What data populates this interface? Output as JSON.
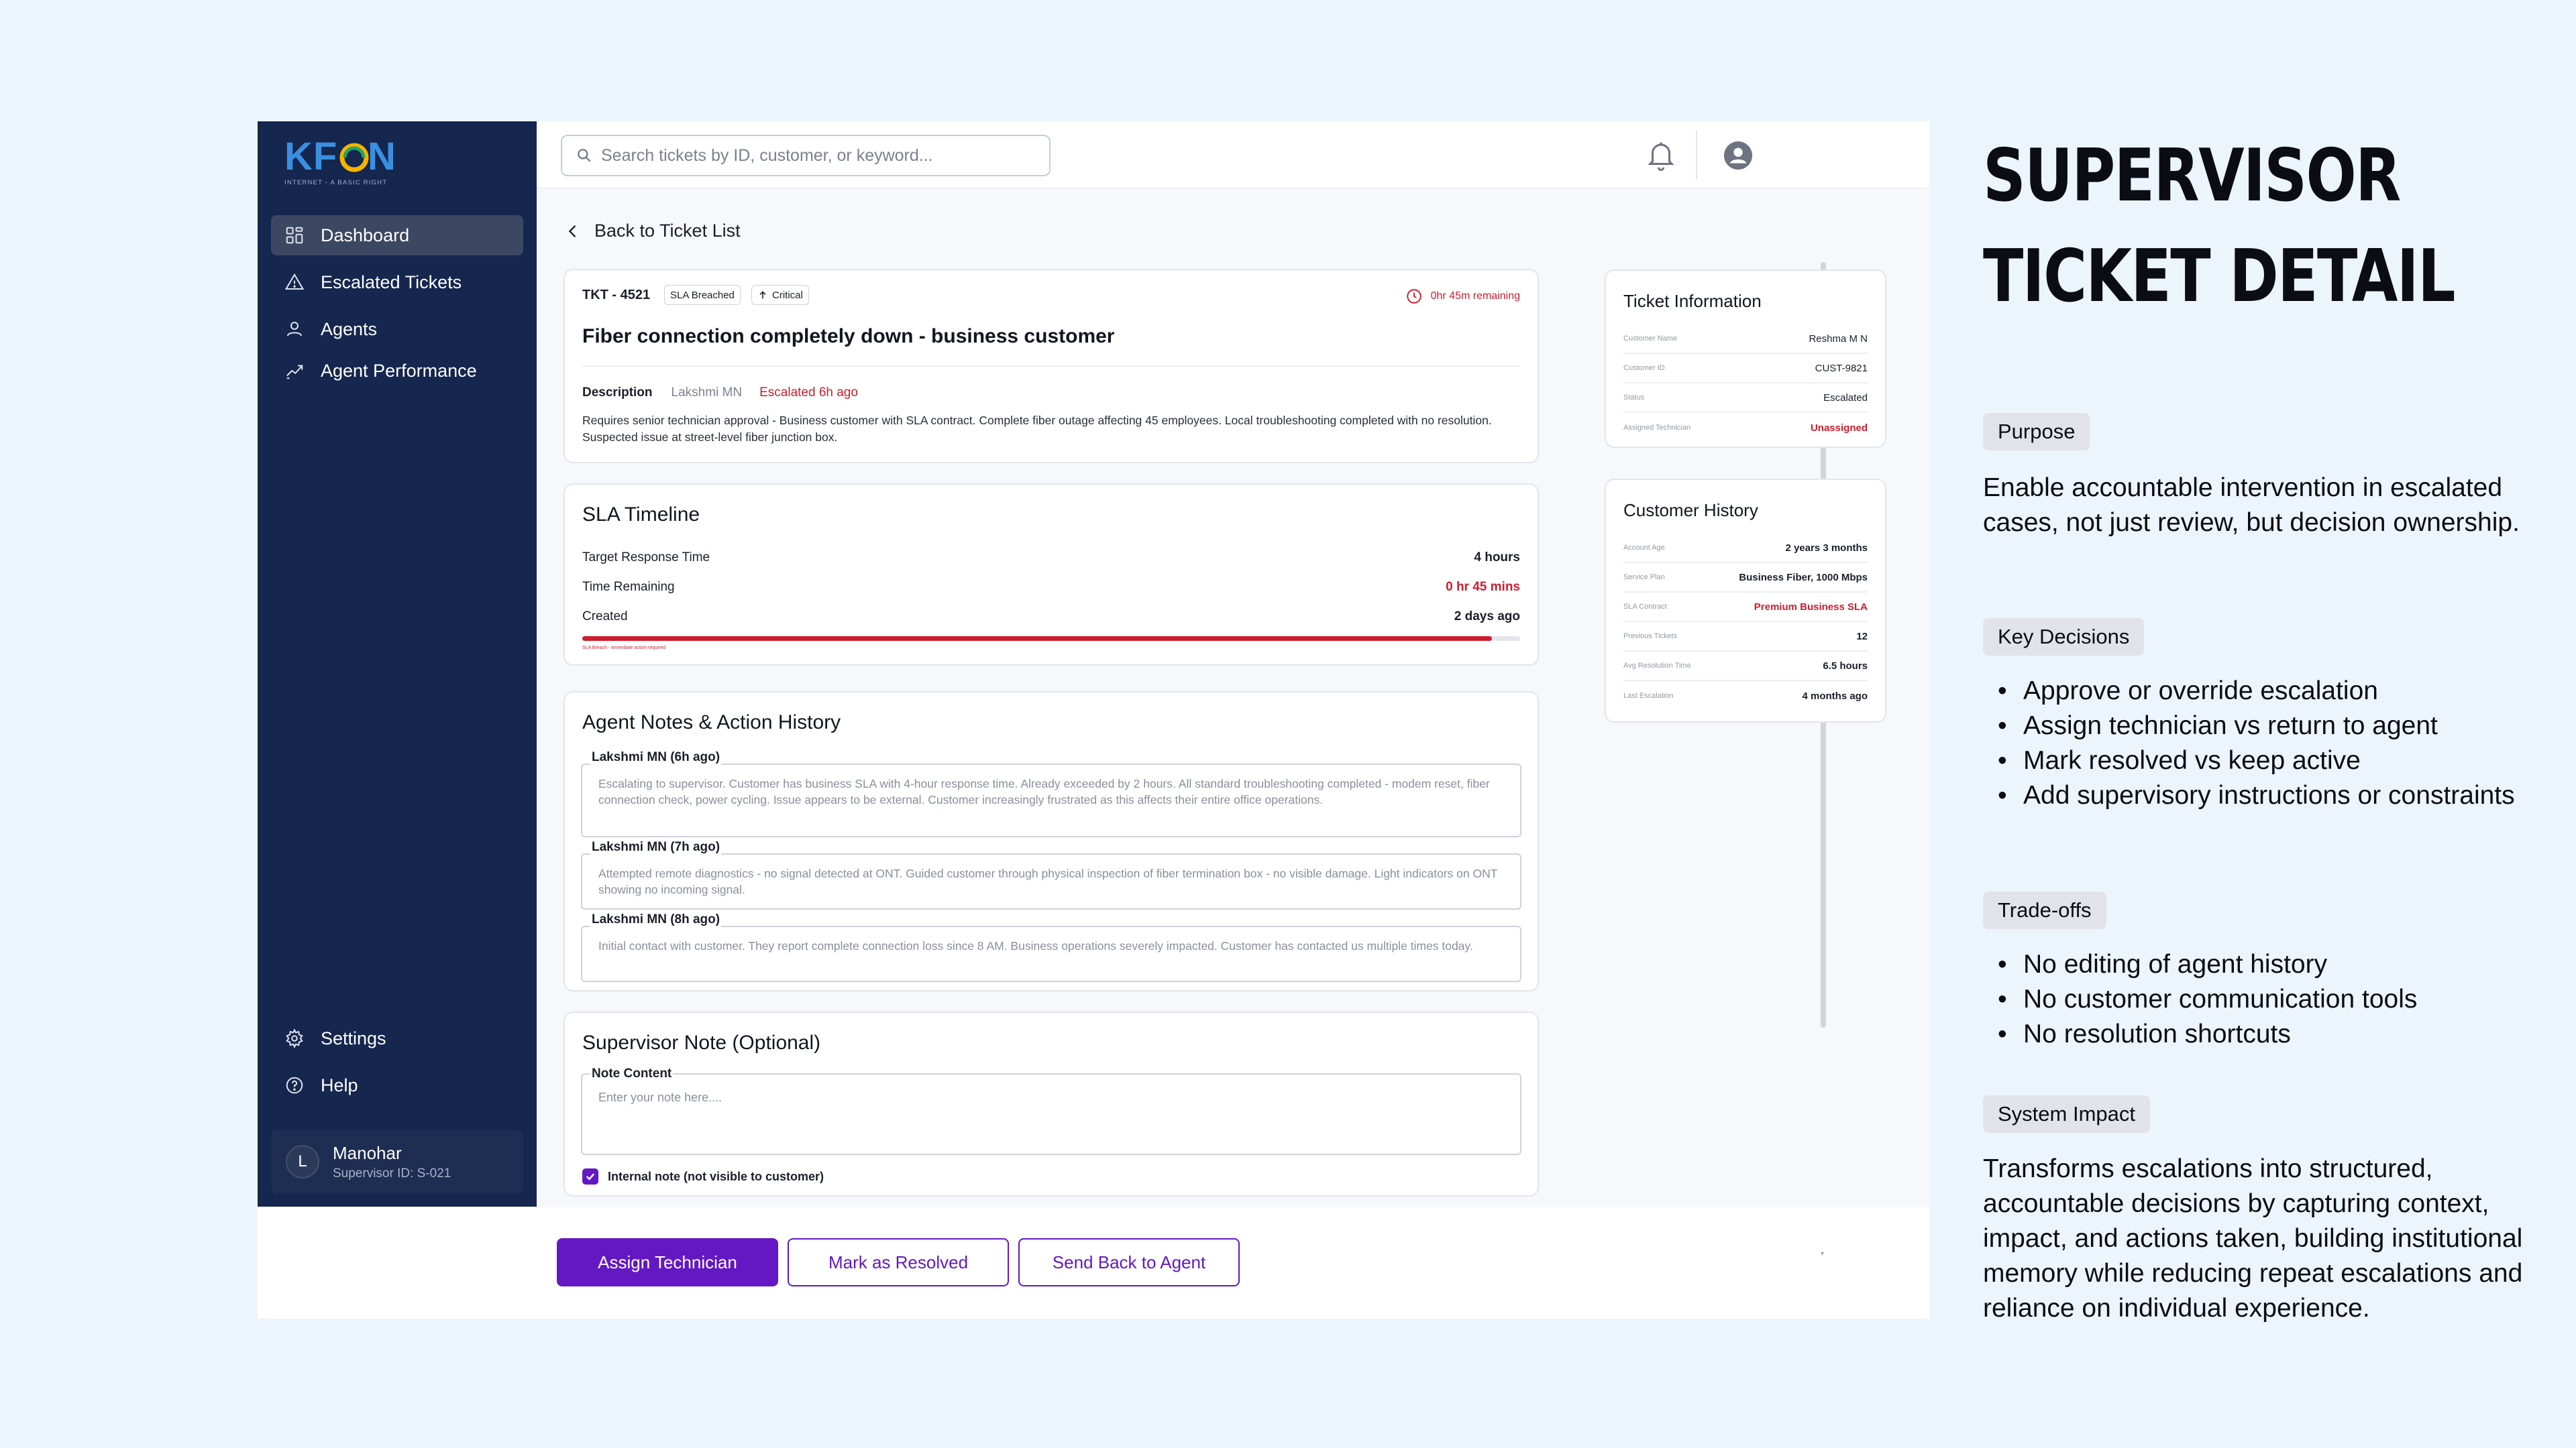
{
  "brand": {
    "logo_text": "KFON",
    "tagline": "INTERNET - A BASIC RIGHT",
    "purple": "#6418c3",
    "navy": "#15264f",
    "danger": "#cf1d2e"
  },
  "sidebar": {
    "items": [
      {
        "label": "Dashboard",
        "icon": "grid-icon",
        "active": true
      },
      {
        "label": "Escalated Tickets",
        "icon": "warning-icon"
      },
      {
        "label": "Agents",
        "icon": "user-icon"
      },
      {
        "label": "Agent Performance",
        "icon": "trend-icon"
      }
    ],
    "bottom": [
      {
        "label": "Settings",
        "icon": "gear-icon"
      },
      {
        "label": "Help",
        "icon": "help-icon"
      }
    ],
    "user": {
      "initial": "L",
      "name": "Manohar",
      "id": "Supervisor ID: S-021"
    }
  },
  "topbar": {
    "search_placeholder": "Search tickets by ID, customer, or keyword..."
  },
  "main": {
    "back_label": "Back to Ticket List",
    "ticket": {
      "id": "TKT - 4521",
      "chip_sla": "SLA Breached",
      "chip_priority": "Critical",
      "timer": "0hr 45m remaining",
      "title": "Fiber connection completely down - business customer",
      "desc_label": "Description",
      "agent": "Lakshmi MN",
      "escalated": "Escalated 6h ago",
      "description": "Requires senior technician approval - Business customer with SLA contract. Complete fiber outage affecting 45 employees. Local troubleshooting completed with no resolution. Suspected issue at street-level fiber junction box."
    },
    "sla": {
      "title": "SLA Timeline",
      "rows": [
        {
          "label": "Target Response Time",
          "value": "4 hours"
        },
        {
          "label": "Time Remaining",
          "value": "0 hr 45 mins"
        },
        {
          "label": "Created",
          "value": "2 days ago"
        }
      ],
      "progress_percent": 97,
      "progress_note": "SLA Breach - immediate action required"
    },
    "notes": {
      "title": "Agent Notes & Action History",
      "items": [
        {
          "author": "Lakshmi MN (6h ago)",
          "text": "Escalating to supervisor. Customer has business SLA with 4-hour response time. Already exceeded by 2 hours. All standard troubleshooting completed - modem reset, fiber connection check, power cycling. Issue appears to be external. Customer increasingly frustrated as this affects their entire office operations."
        },
        {
          "author": "Lakshmi MN (7h ago)",
          "text": "Attempted remote diagnostics - no signal detected at ONT. Guided customer through physical inspection of fiber termination box - no visible damage. Light indicators on ONT showing no incoming signal."
        },
        {
          "author": "Lakshmi MN (8h ago)",
          "text": "Initial contact with customer. They report complete connection loss since 8 AM. Business operations severely impacted. Customer has contacted us multiple times today."
        }
      ]
    },
    "supervisor_note": {
      "title": "Supervisor Note (Optional)",
      "label": "Note Content",
      "placeholder": "Enter your note here....",
      "checkbox_label": "Internal note (not visible to customer)",
      "checked": true
    }
  },
  "ticket_info": {
    "title": "Ticket Information",
    "rows": [
      {
        "label": "Customer Name",
        "value": "Reshma M N"
      },
      {
        "label": "Customer ID",
        "value": "CUST-9821"
      },
      {
        "label": "Status",
        "value": "Escalated"
      },
      {
        "label": "Assigned Technician",
        "value": "Unassigned"
      }
    ]
  },
  "customer_history": {
    "title": "Customer History",
    "rows": [
      {
        "label": "Account Age",
        "value": "2 years 3 months"
      },
      {
        "label": "Service Plan",
        "value": "Business Fiber, 1000 Mbps"
      },
      {
        "label": "SLA Contract",
        "value": "Premium Business SLA"
      },
      {
        "label": "Previous Tickets",
        "value": "12"
      },
      {
        "label": "Avg Resolution Time",
        "value": "6.5 hours"
      },
      {
        "label": "Last Escalation",
        "value": "4 months ago"
      }
    ]
  },
  "actions": {
    "assign": "Assign Technician",
    "resolve": "Mark as Resolved",
    "send_back": "Send Back to Agent"
  },
  "annotation": {
    "title_line1": "SUPERVISOR",
    "title_line2": "TICKET DETAIL",
    "purpose_label": "Purpose",
    "purpose_text": "Enable accountable intervention in escalated cases,  not just review, but decision ownership.",
    "decisions_label": "Key Decisions",
    "decisions": [
      "Approve or override escalation",
      "Assign technician vs return to agent",
      "Mark resolved vs keep active",
      "Add supervisory instructions or constraints"
    ],
    "tradeoffs_label": "Trade-offs",
    "tradeoffs": [
      "No editing of agent history",
      "No customer communication tools",
      "No resolution shortcuts"
    ],
    "impact_label": "System Impact",
    "impact_text": "Transforms escalations into structured, accountable decisions by capturing context, impact, and actions taken, building institutional memory while reducing repeat escalations and reliance on individual experience."
  }
}
